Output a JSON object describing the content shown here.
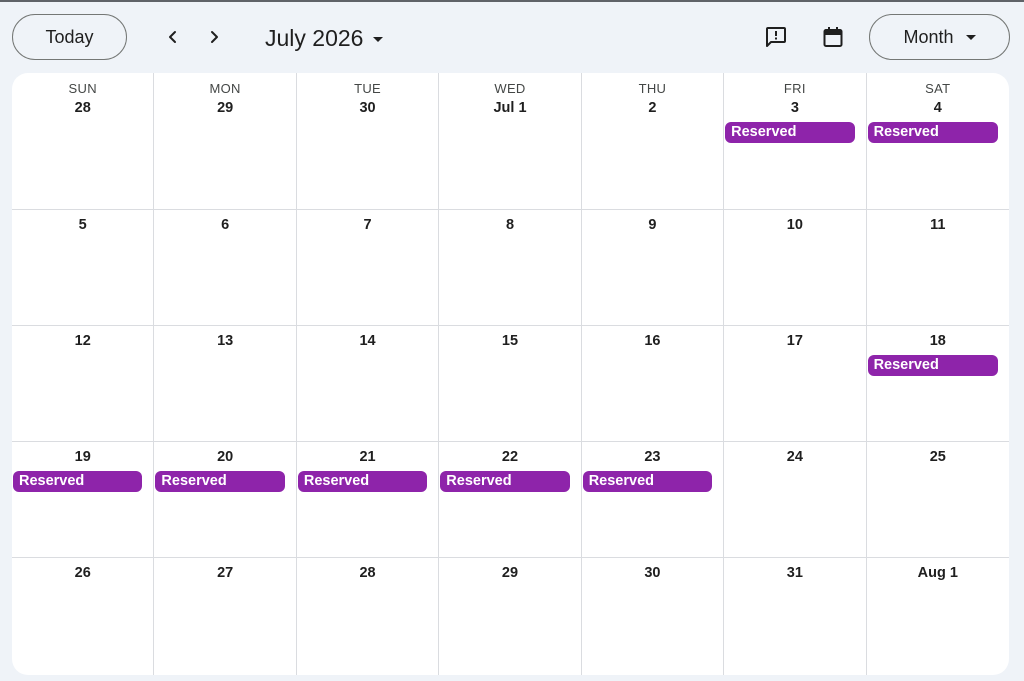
{
  "toolbar": {
    "today_label": "Today",
    "month_title": "July 2026",
    "view_label": "Month",
    "icons": [
      "chevron-left-icon",
      "chevron-right-icon",
      "feedback-icon",
      "calendar-icon"
    ]
  },
  "colors": {
    "event": "#8e24aa",
    "background": "#eff3f8",
    "grid_line": "#dadce0"
  },
  "weekdays": [
    "SUN",
    "MON",
    "TUE",
    "WED",
    "THU",
    "FRI",
    "SAT"
  ],
  "weeks": [
    [
      {
        "date": "28",
        "events": []
      },
      {
        "date": "29",
        "events": []
      },
      {
        "date": "30",
        "events": []
      },
      {
        "date": "Jul 1",
        "events": []
      },
      {
        "date": "2",
        "events": []
      },
      {
        "date": "3",
        "events": [
          "Reserved"
        ]
      },
      {
        "date": "4",
        "events": [
          "Reserved"
        ]
      }
    ],
    [
      {
        "date": "5",
        "events": []
      },
      {
        "date": "6",
        "events": []
      },
      {
        "date": "7",
        "events": []
      },
      {
        "date": "8",
        "events": []
      },
      {
        "date": "9",
        "events": []
      },
      {
        "date": "10",
        "events": []
      },
      {
        "date": "11",
        "events": []
      }
    ],
    [
      {
        "date": "12",
        "events": []
      },
      {
        "date": "13",
        "events": []
      },
      {
        "date": "14",
        "events": []
      },
      {
        "date": "15",
        "events": []
      },
      {
        "date": "16",
        "events": []
      },
      {
        "date": "17",
        "events": []
      },
      {
        "date": "18",
        "events": [
          "Reserved"
        ]
      }
    ],
    [
      {
        "date": "19",
        "events": [
          "Reserved"
        ]
      },
      {
        "date": "20",
        "events": [
          "Reserved"
        ]
      },
      {
        "date": "21",
        "events": [
          "Reserved"
        ]
      },
      {
        "date": "22",
        "events": [
          "Reserved"
        ]
      },
      {
        "date": "23",
        "events": [
          "Reserved"
        ]
      },
      {
        "date": "24",
        "events": []
      },
      {
        "date": "25",
        "events": []
      }
    ],
    [
      {
        "date": "26",
        "events": []
      },
      {
        "date": "27",
        "events": []
      },
      {
        "date": "28",
        "events": []
      },
      {
        "date": "29",
        "events": []
      },
      {
        "date": "30",
        "events": []
      },
      {
        "date": "31",
        "events": []
      },
      {
        "date": "Aug 1",
        "events": []
      }
    ]
  ]
}
